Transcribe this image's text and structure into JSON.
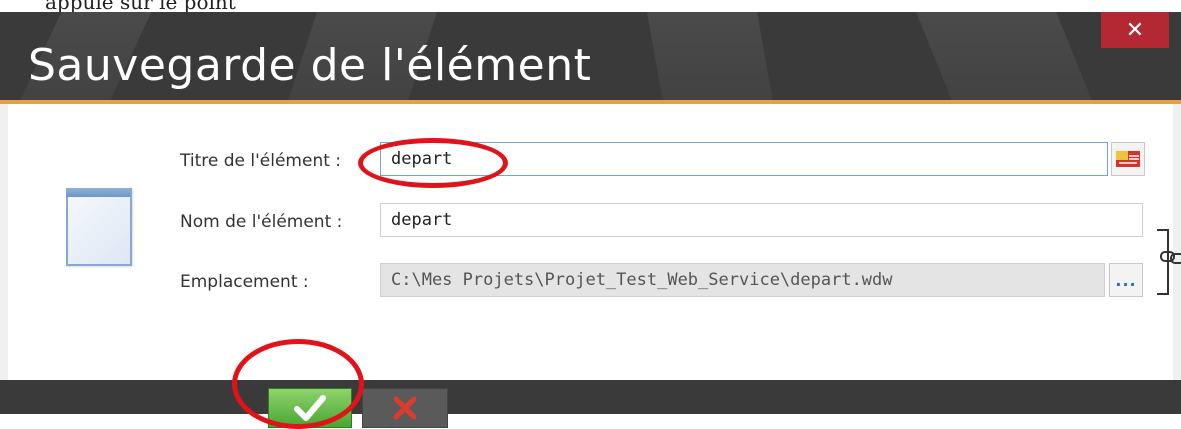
{
  "top_text": "appuie sur le point",
  "dialog": {
    "title": "Sauvegarde de l'élément",
    "close_glyph": "✕",
    "fields": {
      "titre_label": "Titre de l'élément :",
      "titre_value": "depart",
      "nom_label": "Nom de l'élément :",
      "nom_value": "depart",
      "emplacement_label": "Emplacement :",
      "emplacement_value": "C:\\Mes Projets\\Projet_Test_Web_Service\\depart.wdw",
      "browse_label": "..."
    },
    "icons": {
      "document": "window-document-icon",
      "translate": "translate-flag-icon",
      "chain": "chain-link-icon",
      "ok": "checkmark-icon",
      "cancel": "cross-icon"
    }
  },
  "colors": {
    "titlebar": "#3a3a3a",
    "accent_line": "#e7a04a",
    "close": "#b32833",
    "ok": "#4aa532",
    "cancel_x": "#e03a2f",
    "annotation": "#e0131b"
  }
}
